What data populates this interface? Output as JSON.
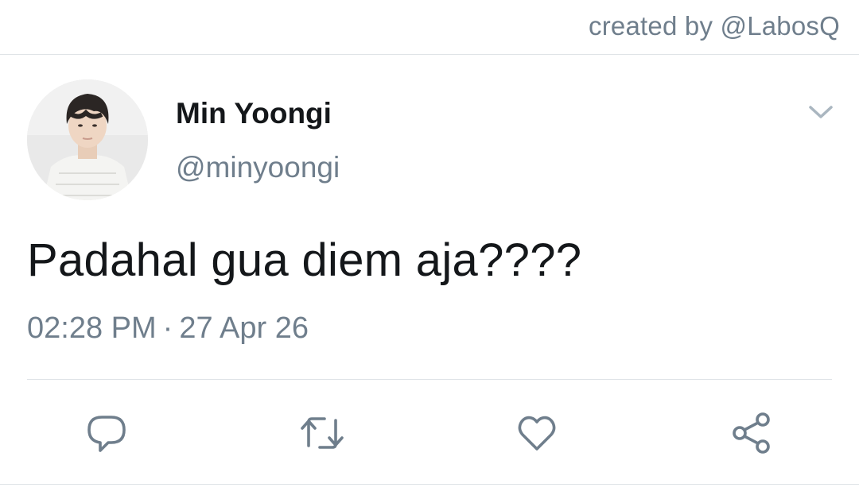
{
  "credit": "created by @LabosQ",
  "tweet": {
    "display_name": "Min Yoongi",
    "handle": "@minyoongi",
    "text": "Padahal gua diem aja????",
    "time": "02:28 PM",
    "separator": "·",
    "date": "27 Apr 26"
  },
  "icons": {
    "more": "chevron-down-icon",
    "reply": "reply-icon",
    "retweet": "retweet-icon",
    "like": "heart-icon",
    "share": "share-icon"
  },
  "colors": {
    "text_primary": "#14171a",
    "text_secondary": "#6f7e8c",
    "icon": "#6f7e8c",
    "divider": "#dfe3e7",
    "background": "#ffffff"
  }
}
